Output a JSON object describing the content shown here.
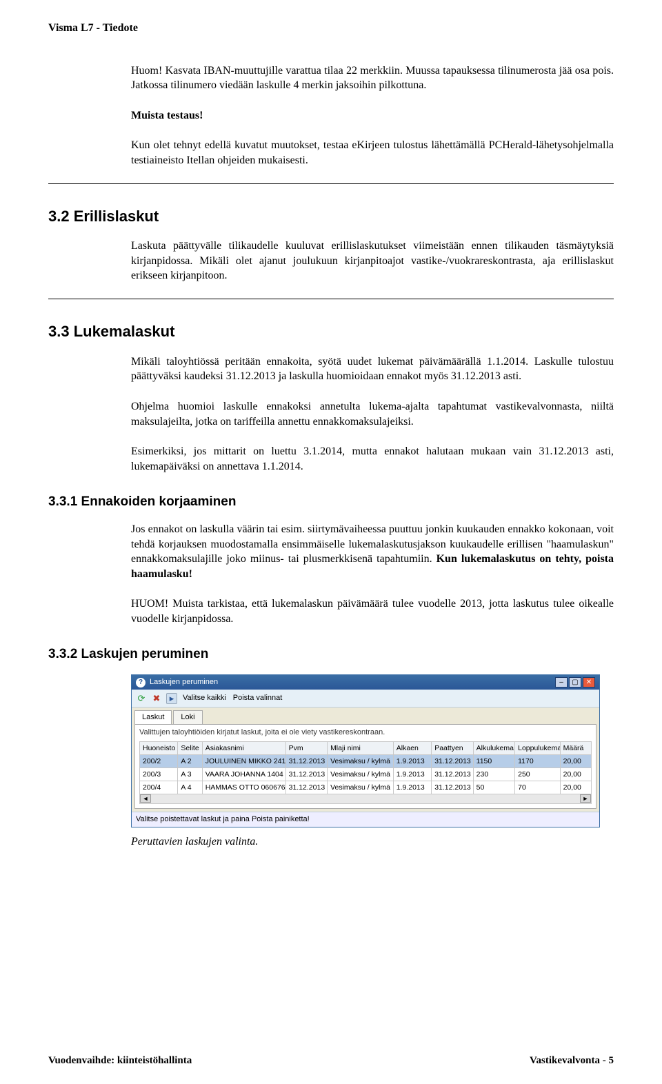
{
  "header": {
    "title": "Visma L7 - Tiedote"
  },
  "para1": "Huom! Kasvata IBAN-muuttujille varattua tilaa 22 merkkiin. Muussa tapauksessa tilinumerosta jää osa pois. Jatkossa tilinumero viedään laskulle 4 merkin jaksoihin pilkottuna.",
  "muista": "Muista testaus!",
  "para2": "Kun olet tehnyt edellä kuvatut muutokset, testaa eKirjeen tulostus lähettämällä PCHerald-lähetysohjelmalla testiaineisto Itellan ohjeiden mukaisesti.",
  "sec32": {
    "title": "3.2  Erillislaskut"
  },
  "para3": "Laskuta päättyvälle tilikaudelle kuuluvat erillislaskutukset viimeistään ennen tilikauden täsmäytyksiä kirjanpidossa. Mikäli olet ajanut joulukuun kirjanpitoajot vastike-/vuokrareskontrasta, aja erillislaskut erikseen kirjanpitoon.",
  "sec33": {
    "title": "3.3  Lukemalaskut"
  },
  "para4": "Mikäli taloyhtiössä peritään ennakoita, syötä uudet lukemat päivämäärällä 1.1.2014. Laskulle tulostuu päättyväksi kaudeksi 31.12.2013 ja laskulla huomioidaan ennakot myös 31.12.2013 asti.",
  "para5": "Ohjelma huomioi laskulle ennakoksi annetulta lukema-ajalta tapahtumat vastikevalvonnasta, niiltä maksulajeilta, jotka on tariffeilla annettu ennakkomaksulajeiksi.",
  "para6": "Esimerkiksi, jos mittarit on luettu 3.1.2014, mutta ennakot halutaan mukaan vain 31.12.2013 asti, lukemapäiväksi on annettava 1.1.2014.",
  "sec331": {
    "title": "3.3.1 Ennakoiden korjaaminen"
  },
  "para7a": "Jos ennakot on laskulla väärin tai esim. siirtymävaiheessa puuttuu jonkin kuukauden ennakko kokonaan, voit tehdä korjauksen muodostamalla ensimmäiselle lukemalaskutusjakson kuukaudelle erillisen \"haamulaskun\" ennakkomaksulajille joko miinus- tai plusmerkkisenä tapahtumiin. ",
  "para7b": "Kun lukemalaskutus on tehty, poista haamulasku!",
  "para8": "HUOM! Muista tarkistaa, että lukemalaskun päivämäärä tulee vuodelle 2013, jotta laskutus tulee oikealle vuodelle kirjanpidossa.",
  "sec332": {
    "title": "3.3.2 Laskujen peruminen"
  },
  "caption": "Peruttavien laskujen valinta.",
  "footer": {
    "left": "Vuodenvaihde: kiinteistöhallinta",
    "right": "Vastikevalvonta - 5"
  },
  "window": {
    "title": "Laskujen peruminen",
    "toolbar": {
      "valitse": "Valitse kaikki",
      "poista": "Poista valinnat"
    },
    "tabs": {
      "laskut": "Laskut",
      "loki": "Loki"
    },
    "desc": "Valittujen taloyhtiöiden kirjatut laskut, joita ei ole viety vastikereskontraan.",
    "columns": [
      "Huoneisto",
      "Selite",
      "Asiakasnimi",
      "Pvm",
      "Mlaji nimi",
      "Alkaen",
      "Paattyen",
      "Alkulukema",
      "Loppulukema",
      "Määrä"
    ],
    "rows": [
      {
        "huoneisto": "200/2",
        "selite": "A 2",
        "asiakas": "JOULUINEN MIKKO 241",
        "pvm": "31.12.2013",
        "mlaji": "Vesimaksu / kylmä",
        "alkaen": "1.9.2013",
        "paattyen": "31.12.2013",
        "alku": "1150",
        "loppu": "1170",
        "maara": "20,00"
      },
      {
        "huoneisto": "200/3",
        "selite": "A 3",
        "asiakas": "VAARA JOHANNA 1404",
        "pvm": "31.12.2013",
        "mlaji": "Vesimaksu / kylmä",
        "alkaen": "1.9.2013",
        "paattyen": "31.12.2013",
        "alku": "230",
        "loppu": "250",
        "maara": "20,00"
      },
      {
        "huoneisto": "200/4",
        "selite": "A 4",
        "asiakas": "HAMMAS OTTO 060676",
        "pvm": "31.12.2013",
        "mlaji": "Vesimaksu / kylmä",
        "alkaen": "1.9.2013",
        "paattyen": "31.12.2013",
        "alku": "50",
        "loppu": "70",
        "maara": "20,00"
      }
    ],
    "status": "Valitse poistettavat laskut ja paina Poista painiketta!"
  }
}
